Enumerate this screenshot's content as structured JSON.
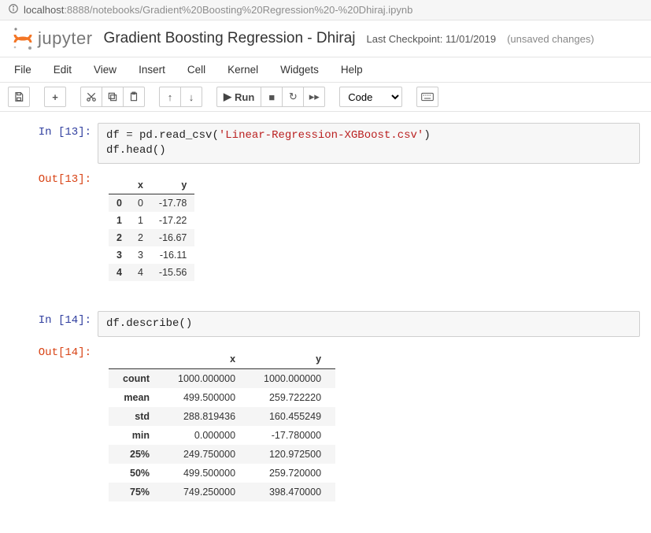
{
  "url": {
    "host": "localhost",
    "port": ":8888",
    "path": "/notebooks/Gradient%20Boosting%20Regression%20-%20Dhiraj.ipynb"
  },
  "header": {
    "brand": "jupyter",
    "title": "Gradient Boosting Regression - Dhiraj",
    "checkpoint_label": "Last Checkpoint: 11/01/2019",
    "unsaved": "(unsaved changes)"
  },
  "menu": {
    "file": "File",
    "edit": "Edit",
    "view": "View",
    "insert": "Insert",
    "cell": "Cell",
    "kernel": "Kernel",
    "widgets": "Widgets",
    "help": "Help"
  },
  "toolbar": {
    "run_label": "Run",
    "cell_type_value": "Code",
    "icons": {
      "save": "save-icon",
      "add": "add-icon",
      "cut": "cut-icon",
      "copy": "copy-icon",
      "paste": "paste-icon",
      "up": "up-icon",
      "down": "down-icon",
      "run": "run-icon",
      "stop": "stop-icon",
      "restart": "restart-icon",
      "fast-forward": "fast-forward-icon",
      "keyboard": "keyboard-icon"
    }
  },
  "cells": [
    {
      "kind": "code",
      "in_prompt": "In [13]:",
      "code_line1_a": "df ",
      "code_line1_eq": "= ",
      "code_line1_b": "pd.read_csv(",
      "code_line1_str": "'Linear-Regression-XGBoost.csv'",
      "code_line1_c": ")",
      "code_line2_a": "df.head(",
      "code_line2_b": ")",
      "out_prompt": "Out[13]:",
      "table": {
        "columns": [
          "x",
          "y"
        ],
        "index": [
          "0",
          "1",
          "2",
          "3",
          "4"
        ],
        "rows": [
          [
            "0",
            "-17.78"
          ],
          [
            "1",
            "-17.22"
          ],
          [
            "2",
            "-16.67"
          ],
          [
            "3",
            "-16.11"
          ],
          [
            "4",
            "-15.56"
          ]
        ]
      }
    },
    {
      "kind": "code",
      "in_prompt": "In [14]:",
      "code_line1_a": "df.describe(",
      "code_line1_b": ")",
      "out_prompt": "Out[14]:",
      "table": {
        "columns": [
          "x",
          "y"
        ],
        "index": [
          "count",
          "mean",
          "std",
          "min",
          "25%",
          "50%",
          "75%"
        ],
        "rows": [
          [
            "1000.000000",
            "1000.000000"
          ],
          [
            "499.500000",
            "259.722220"
          ],
          [
            "288.819436",
            "160.455249"
          ],
          [
            "0.000000",
            "-17.780000"
          ],
          [
            "249.750000",
            "120.972500"
          ],
          [
            "499.500000",
            "259.720000"
          ],
          [
            "749.250000",
            "398.470000"
          ]
        ]
      }
    }
  ]
}
